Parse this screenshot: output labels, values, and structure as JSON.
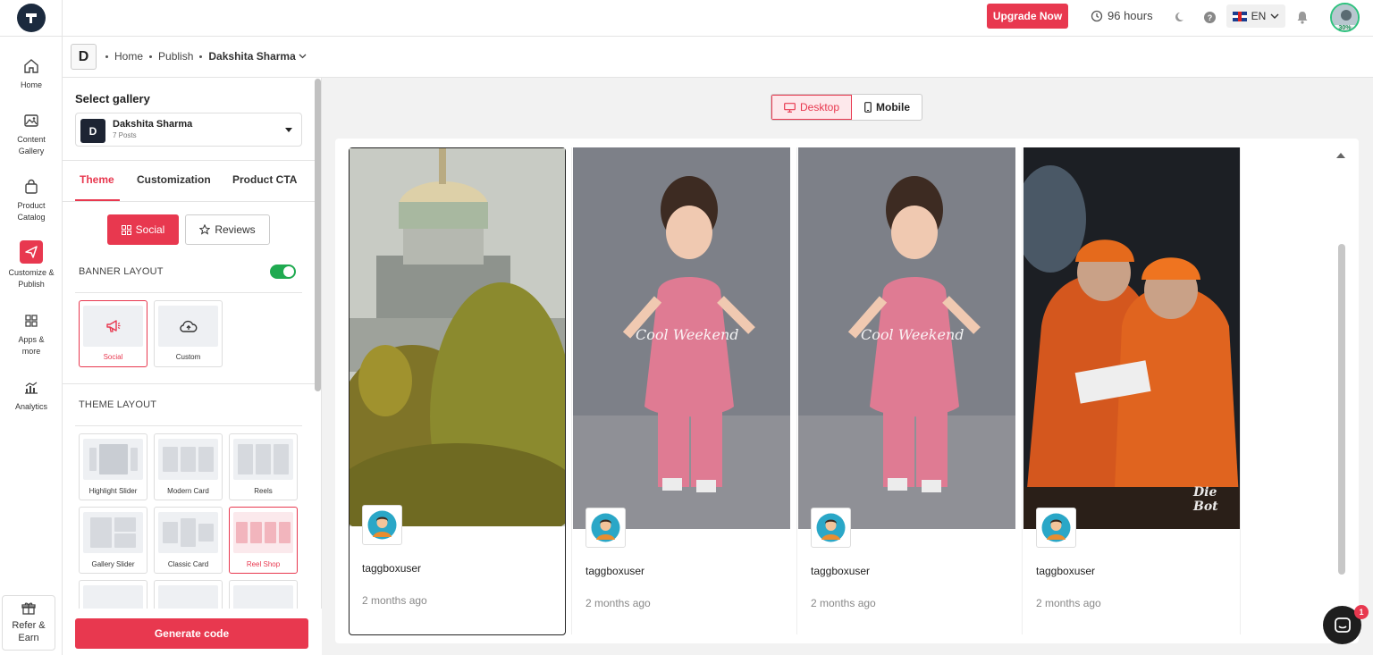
{
  "topbar": {
    "upgrade_label": "Upgrade Now",
    "hours_label": "96 hours",
    "language": "EN",
    "profile_progress": "30%"
  },
  "nav": {
    "home": "Home",
    "content_gallery": "Content Gallery",
    "product_catalog": "Product Catalog",
    "customize_publish": "Customize & Publish",
    "apps_more": "Apps & more",
    "analytics": "Analytics",
    "refer_earn": "Refer & Earn"
  },
  "breadcrumb": {
    "badge": "D",
    "home": "Home",
    "publish": "Publish",
    "current": "Dakshita Sharma"
  },
  "panel": {
    "select_gallery_title": "Select gallery",
    "gallery_badge": "D",
    "gallery_name": "Dakshita Sharma",
    "gallery_posts": "7 Posts",
    "tabs": [
      "Theme",
      "Customization",
      "Product CTA"
    ],
    "social_label": "Social",
    "reviews_label": "Reviews",
    "banner_layout_label": "BANNER LAYOUT",
    "banner_cards": [
      "Social",
      "Custom"
    ],
    "theme_layout_label": "THEME LAYOUT",
    "theme_cards": [
      "Highlight Slider",
      "Modern Card",
      "Reels",
      "Gallery Slider",
      "Classic Card",
      "Reel Shop"
    ],
    "generate_label": "Generate code"
  },
  "preview": {
    "desktop_label": "Desktop",
    "mobile_label": "Mobile",
    "posts": [
      {
        "user": "taggboxuser",
        "time": "2 months ago",
        "overlay": ""
      },
      {
        "user": "taggboxuser",
        "time": "2 months ago",
        "overlay": "Cool Weekend"
      },
      {
        "user": "taggboxuser",
        "time": "2 months ago",
        "overlay": "Cool Weekend"
      },
      {
        "user": "taggboxuser",
        "time": "2 months ago",
        "overlay": "Die Bot"
      }
    ]
  },
  "chat": {
    "badge": "1"
  },
  "colors": {
    "accent": "#e8384f",
    "toggle_on": "#1faa50",
    "dark": "#1b2a3e"
  }
}
